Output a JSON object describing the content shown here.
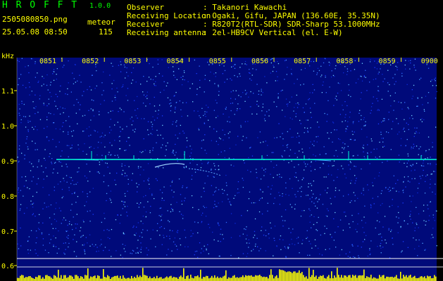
{
  "header": {
    "app_name": "H R O F F T",
    "version": "1.0.0",
    "filename": "2505080850.png",
    "event_type": "meteor",
    "datetime": "25.05.08 08:50",
    "count": "115",
    "info_labels": [
      "Observer",
      "Receiving Location",
      "Receiver",
      "Receiving antenna"
    ],
    "info_values": [
      ": Takanori Kawachi",
      ": Ogaki, Gifu, JAPAN (136.60E, 35.35N)",
      ": R820T2(RTL-SDR) SDR-Sharp 53.1000MHz",
      ": 2el-HB9CV Vertical (el. E-W)"
    ]
  },
  "spectrogram": {
    "y_unit": "kHz",
    "y_ticks": [
      "1.1",
      "1.0",
      "0.9",
      "0.8",
      "0.7",
      "0.6"
    ],
    "time_labels": [
      "0851",
      "0852",
      "0853",
      "0854",
      "0855",
      "0856",
      "0857",
      "0858",
      "0859",
      "0900"
    ],
    "colors": {
      "background": "#000000",
      "noise_base": "#000a7a",
      "carrier": "#00ffd8",
      "grid": "#ffffff",
      "label": "#ffff00",
      "power_bars": "#ffff00"
    }
  }
}
